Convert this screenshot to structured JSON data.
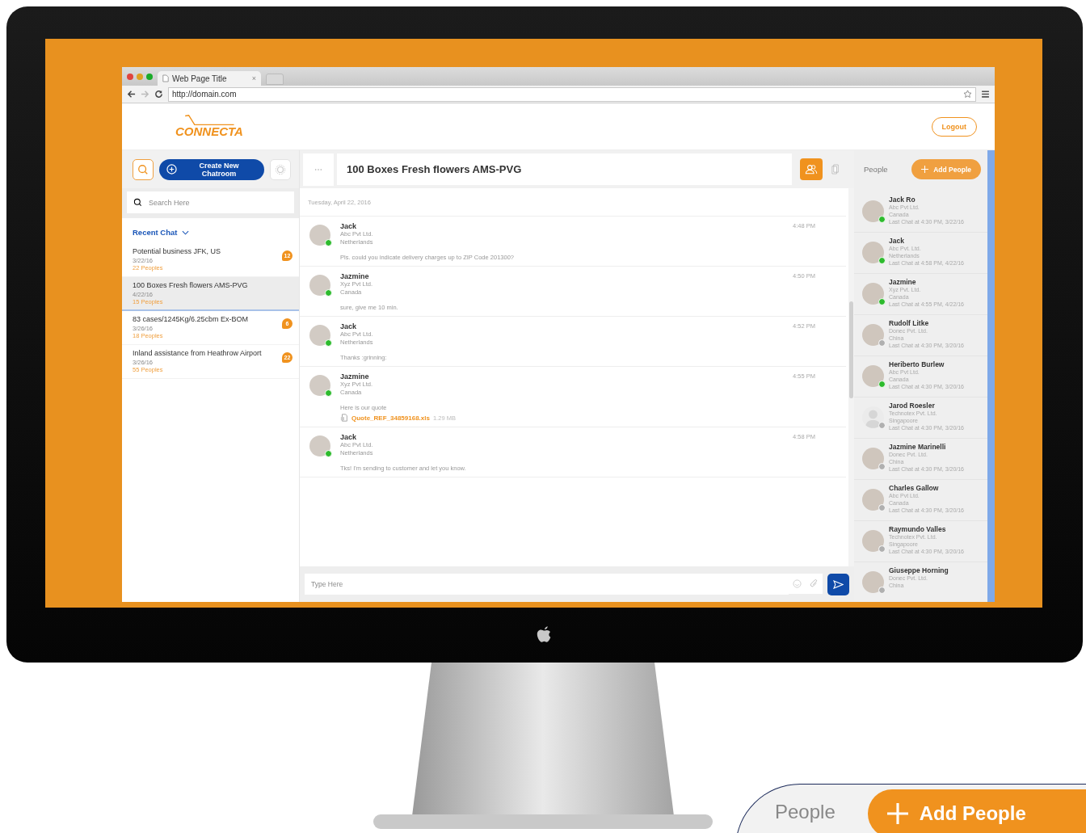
{
  "browser": {
    "tab_title": "Web Page Title",
    "tab_close": "×",
    "url": "http://domain.com"
  },
  "header": {
    "logo": "CONNECTA",
    "logout": "Logout"
  },
  "sidebar": {
    "create_button": "Create New Chatroom",
    "search_placeholder": "Search Here",
    "section": "Recent Chat",
    "chats": [
      {
        "title": "Potential business JFK, US",
        "date": "3/22/16",
        "people": "22 Peoples",
        "badge": "12",
        "selected": false
      },
      {
        "title": "100 Boxes Fresh flowers AMS-PVG",
        "date": "4/22/16",
        "people": "15 Peoples",
        "selected": true
      },
      {
        "title": "83 cases/1245Kg/6.25cbm Ex-BOM",
        "date": "3/26/16",
        "people": "18 Peoples",
        "badge": "6",
        "selected": false
      },
      {
        "title": "Inland assistance from Heathrow Airport",
        "date": "3/26/16",
        "people": "55 Peoples",
        "badge": "22",
        "selected": false
      }
    ]
  },
  "chat": {
    "title": "100 Boxes Fresh flowers AMS-PVG",
    "date": "Tuesday, April 22, 2016",
    "messages": [
      {
        "name": "Jack",
        "company": "Abc Pvt Ltd.",
        "country": "Netherlands",
        "time": "4:48 PM",
        "text": "Pls. could you indicate delivery charges up to ZIP Code 201300?",
        "online": true
      },
      {
        "name": "Jazmine",
        "company": "Xyz Pvt Ltd.",
        "country": "Canada",
        "time": "4:50 PM",
        "text": "sure, give me 10 min.",
        "online": true
      },
      {
        "name": "Jack",
        "company": "Abc Pvt Ltd.",
        "country": "Netherlands",
        "time": "4:52 PM",
        "text": "Thanks :grinning:",
        "online": true
      },
      {
        "name": "Jazmine",
        "company": "Xyz Pvt Ltd.",
        "country": "Canada",
        "time": "4:55 PM",
        "text": "Here is our quote",
        "attachment": {
          "name": "Quote_REF_34859168.xls",
          "size": "1.29 MB"
        },
        "online": true
      },
      {
        "name": "Jack",
        "company": "Abc Pvt Ltd.",
        "country": "Netherlands",
        "time": "4:58 PM",
        "text": "Tks! I'm sending to customer and let you know.",
        "online": true
      }
    ],
    "input_placeholder": "Type Here"
  },
  "people": {
    "label": "People",
    "add_button": "Add People",
    "list": [
      {
        "name": "Jack Ro",
        "company": "Abc Pvt Ltd.",
        "country": "Canada",
        "last_chat": "Last Chat at 4:30 PM, 3/22/16",
        "online": true,
        "kind": "photo"
      },
      {
        "name": "Jack",
        "company": "Abc Pvt. Ltd.",
        "country": "Netherlands",
        "last_chat": "Last Chat at 4:58 PM, 4/22/16",
        "online": true,
        "kind": "photo"
      },
      {
        "name": "Jazmine",
        "company": "Xyz Pvt. Ltd.",
        "country": "Canada",
        "last_chat": "Last Chat at 4:55 PM, 4/22/16",
        "online": true,
        "kind": "photo"
      },
      {
        "name": "Rudolf Litke",
        "company": "Donec Pvt. Ltd.",
        "country": "China",
        "last_chat": "Last Chat at 4:30 PM, 3/20/16",
        "online": false,
        "kind": "photo"
      },
      {
        "name": "Heriberto Burlew",
        "company": "Abc Pvt Ltd.",
        "country": "Canada",
        "last_chat": "Last Chat at 4:30 PM, 3/20/16",
        "online": true,
        "kind": "photo"
      },
      {
        "name": "Jarod Roesler",
        "company": "Technotex Pvt. Ltd.",
        "country": "Singapoore",
        "last_chat": "Last Chat at 4:30 PM, 3/20/16",
        "online": false,
        "kind": "silhouette"
      },
      {
        "name": "Jazmine Marinelli",
        "company": "Donec Pvt. Ltd.",
        "country": "China",
        "last_chat": "Last Chat at 4:30 PM, 3/20/16",
        "online": false,
        "kind": "photo"
      },
      {
        "name": "Charles Gallow",
        "company": "Abc Pvt Ltd.",
        "country": "Canada",
        "last_chat": "Last Chat at 4:30 PM, 3/20/16",
        "online": false,
        "kind": "photo"
      },
      {
        "name": "Raymundo Valles",
        "company": "Technotex Pvt. Ltd.",
        "country": "Singapoore",
        "last_chat": "Last Chat at 4:30 PM, 3/20/16",
        "online": false,
        "kind": "photo"
      },
      {
        "name": "Giuseppe Horning",
        "company": "Donec Pvt. Ltd.",
        "country": "China",
        "online": false,
        "kind": "photo"
      }
    ]
  },
  "inset": {
    "label": "People",
    "add_button": "Add People"
  }
}
